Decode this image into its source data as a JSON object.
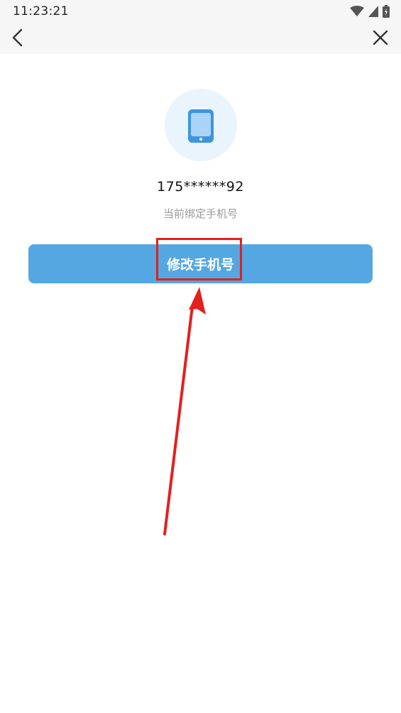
{
  "status_bar": {
    "time": "11:23:21"
  },
  "nav": {
    "back_icon": "chevron-left-icon",
    "close_icon": "close-icon"
  },
  "content": {
    "icon": "phone-icon",
    "phone_number": "175******92",
    "bound_label": "当前绑定手机号",
    "change_button_label": "修改手机号"
  },
  "annotation": {
    "highlight_color": "#e3201e",
    "arrow_color": "#e3201e"
  },
  "colors": {
    "accent": "#55a7e2",
    "icon_circle_bg": "#eaf4fd",
    "topbar_bg": "#f6f6f6"
  }
}
